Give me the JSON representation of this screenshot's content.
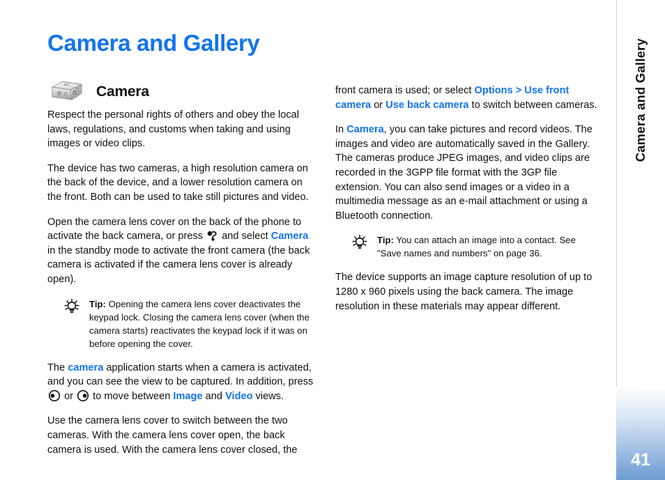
{
  "document": {
    "title": "Camera and Gallery",
    "page_number": "41",
    "side_tab_title": "Camera and Gallery",
    "accent_color": "#1273ef",
    "tab_color": "#6e9bd2"
  },
  "section": {
    "icon": "camera-icon",
    "heading": "Camera"
  },
  "left_column": {
    "p1": "Respect the personal rights of others and obey the local laws, regulations, and customs when taking and using images or video clips.",
    "p2": "The device has two cameras, a high resolution camera on the back of the device, and a lower resolution camera on the front. Both can be used to take still pictures and video.",
    "p3_a": "Open the camera lens cover on the back of the phone to activate the back camera, or press",
    "p3_icon": "menu-key-icon",
    "p3_b": "and select",
    "p3_link": "Camera",
    "p3_c": "in the standby mode to activate the front camera (the back camera is activated if the camera lens cover is already open).",
    "tip": {
      "icon": "tip-bulb-icon",
      "label": "Tip:",
      "text": "Opening the camera lens cover deactivates the keypad lock. Closing the camera lens cover (when the camera starts) reactivates the keypad lock if it was on before opening the cover."
    },
    "p4_a": "The",
    "p4_link1": "camera",
    "p4_b": "application starts when a camera is activated, and you can see the view to be captured. In addition, press",
    "p4_icon_left": "scroll-left-icon",
    "p4_or": "or",
    "p4_icon_right": "scroll-right-icon",
    "p4_c": "to move between",
    "p4_link2": "Image",
    "p4_d": "and",
    "p4_link3": "Video",
    "p4_e": "views.",
    "p5": "Use the camera lens cover to switch between the two cameras. With the camera lens cover open, the back camera is used. With the camera lens cover closed, the"
  },
  "right_column": {
    "p1_a": "front camera is used; or select",
    "p1_link1": "Options > Use front camera",
    "p1_b": "or",
    "p1_link2": "Use back camera",
    "p1_c": "to switch between cameras.",
    "p2_a": "In",
    "p2_link": "Camera",
    "p2_b": ", you can take pictures and record videos. The images and video are automatically saved in the Gallery. The cameras produce JPEG images, and video clips are recorded in the 3GPP file format with the 3GP file extension. You can also send images or a video in a multimedia message as an e-mail attachment or using a Bluetooth connection.",
    "tip": {
      "icon": "tip-bulb-icon",
      "label": "Tip:",
      "text": "You can attach an image into a contact. See \"Save names and numbers\" on page 36."
    },
    "p3": "The device supports an image capture resolution of up to 1280 x 960 pixels using the back camera. The image resolution in these materials may appear different."
  }
}
